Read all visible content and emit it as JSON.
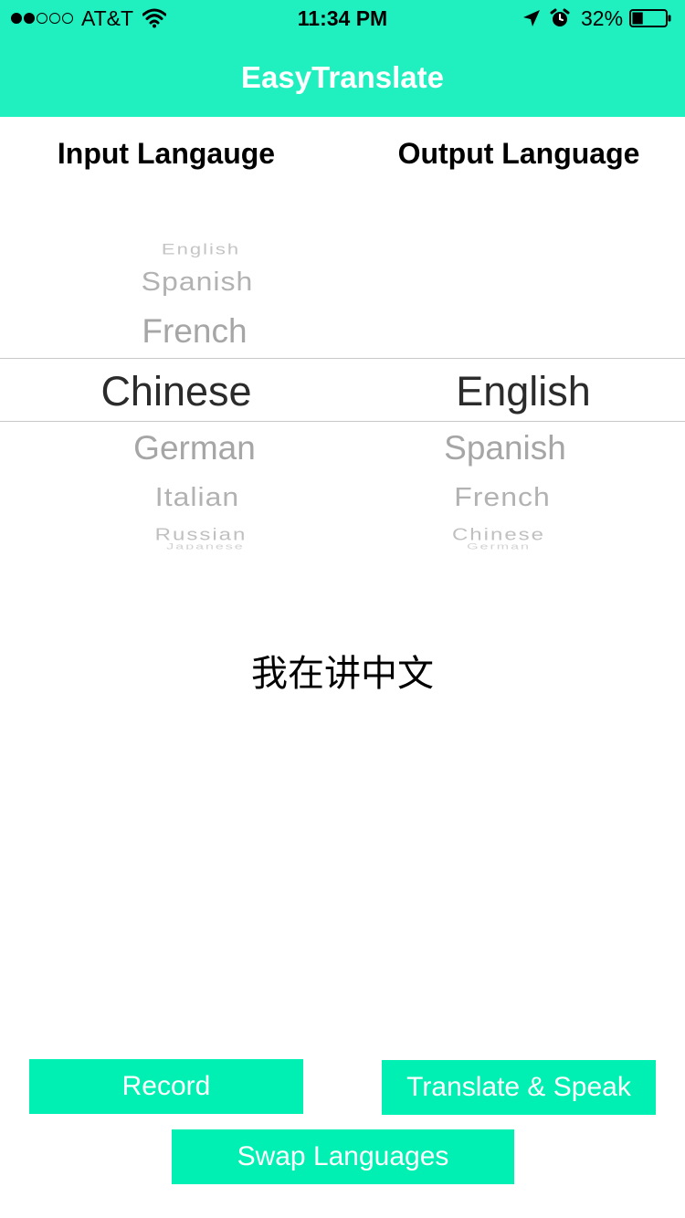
{
  "status_bar": {
    "carrier": "AT&T",
    "time": "11:34 PM",
    "battery_percent": "32%",
    "battery_level": 0.32,
    "signal_bars_filled": 2,
    "signal_bars_total": 5
  },
  "nav": {
    "title": "EasyTranslate"
  },
  "headers": {
    "input": "Input Langauge",
    "output": "Output Language"
  },
  "input_picker": {
    "above": [
      "English",
      "Spanish",
      "French"
    ],
    "selected": "Chinese",
    "below": [
      "German",
      "Italian",
      "Russian",
      "Japanese"
    ]
  },
  "output_picker": {
    "selected": "English",
    "below": [
      "Spanish",
      "French",
      "Chinese",
      "German"
    ]
  },
  "spoken_text": "我在讲中文",
  "buttons": {
    "record": "Record",
    "translate": "Translate & Speak",
    "swap": "Swap Languages"
  },
  "colors": {
    "accent": "#20f0c0",
    "button": "#00f0b4"
  }
}
